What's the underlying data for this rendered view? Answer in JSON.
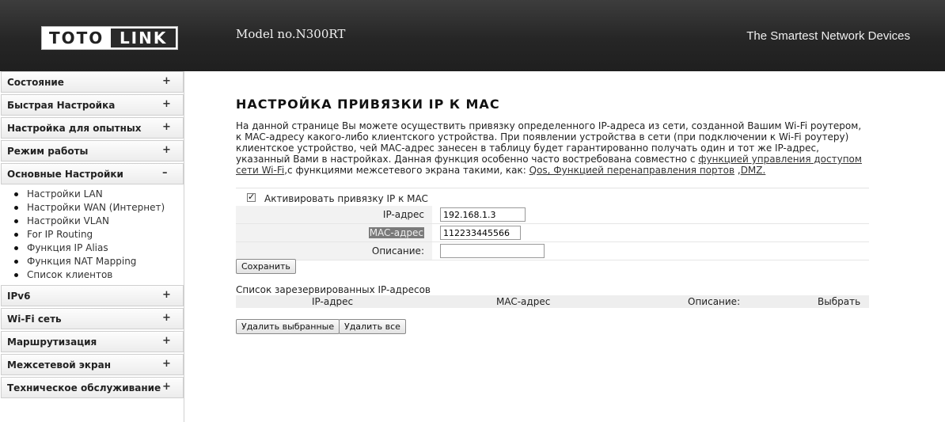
{
  "header": {
    "logo_part1": "TOTO",
    "logo_part2": "LINK",
    "model": "Model no.N300RT",
    "tagline": "The Smartest Network Devices"
  },
  "sidebar": {
    "items_top": [
      {
        "label": "Состояние",
        "toggle": "+"
      },
      {
        "label": "Быстрая Настройка",
        "toggle": "+"
      },
      {
        "label": "Настройка для опытных",
        "toggle": "+"
      },
      {
        "label": "Режим работы",
        "toggle": "+"
      },
      {
        "label": "Основные Настройки",
        "toggle": "–"
      }
    ],
    "submenu": [
      "Настройки LAN",
      "Настройки WAN (Интернет)",
      "Настройки VLAN",
      "For IP Routing",
      "Функция IP Alias",
      "Функция NAT Mapping",
      "Список клиентов"
    ],
    "items_bottom": [
      {
        "label": "IPv6",
        "toggle": "+"
      },
      {
        "label": "Wi-Fi сеть",
        "toggle": "+"
      },
      {
        "label": "Маршрутизация",
        "toggle": "+"
      },
      {
        "label": "Межсетевой экран",
        "toggle": "+"
      },
      {
        "label": "Техническое обслуживание",
        "toggle": "+"
      }
    ]
  },
  "main": {
    "title": "НАСТРОЙКА ПРИВЯЗКИ IP К MAC",
    "desc_text": "На данной странице Вы можете осуществить привязку определенного IP-адреса из сети, созданной Вашим Wi-Fi роутером, к MAC-адресу какого-либо клиентского устройства. При появлении устройства в сети (при подключении к Wi-Fi роутеру) клиентское устройство, чей MAC-адрес занесен в таблицу будет гарантированно получать один и тот же IP-адрес, указанный Вами в настройках. Данная функция особенно часто востребована совместно с ",
    "desc_link1": "функцией управления доступом сети Wi-Fi",
    "desc_mid": ",с функциями межсетевого экрана такими, как: ",
    "desc_link2": "Qos, Функцией перенаправления портов",
    "desc_sep": " ,",
    "desc_link3": "DMZ.",
    "enable_label": "Активировать привязку IP к MAC",
    "enable_checked": true,
    "form": {
      "ip_label": "IP-адрес",
      "ip_value": "192.168.1.3",
      "mac_label": "MAC-адрес",
      "mac_value": "112233445566",
      "desc_label": "Описание:",
      "desc_value": ""
    },
    "save_button": "Сохранить",
    "list_title": "Список зарезервированных IP-адресов",
    "list_columns": [
      "IP-адрес",
      "MAC-адрес",
      "Описание:",
      "Выбрать"
    ],
    "delete_selected_button": "Удалить выбранные",
    "delete_all_button": "Удалить все"
  }
}
